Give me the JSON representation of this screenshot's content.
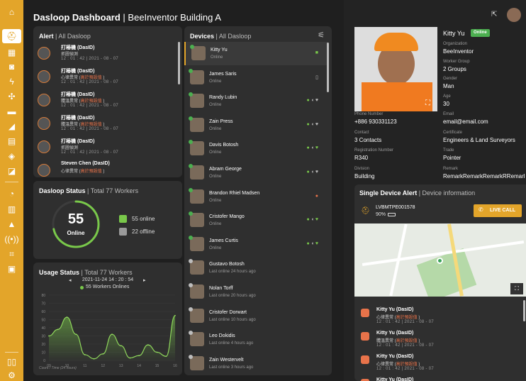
{
  "header": {
    "title": "Dasloop Dashboard",
    "subtitle": "BeeInventor Building A"
  },
  "sidebar": {
    "items": [
      "home-icon",
      "helmet-icon",
      "truck-icon",
      "gas-detector-icon",
      "power-icon",
      "fan-icon",
      "vehicle-icon",
      "excavator-icon",
      "panel-icon",
      "tag-icon",
      "camera-icon",
      "gauge-icon",
      "report-icon",
      "warning-icon",
      "broadcast-icon",
      "path-icon",
      "building-icon",
      "book-icon",
      "settings-icon"
    ]
  },
  "alert": {
    "title": "Alert",
    "scope": "All Dasloop",
    "items": [
      {
        "name": "打樁機 (DasID)",
        "event": "抓圖偵測",
        "warn": "",
        "time": "12 : 01 : 42",
        "date": "2021 - 08 - 07"
      },
      {
        "name": "打樁機 (DasID)",
        "event": "心律異常 (",
        "warn": "高於預設值",
        "time": "12 : 01 : 42",
        "date": "2021 - 08 - 07"
      },
      {
        "name": "打樁機 (DasID)",
        "event": "體溫異常 (",
        "warn": "高於預設值",
        "time": "12 : 01 : 42",
        "date": "2021 - 08 - 07"
      },
      {
        "name": "打樁機 (DasID)",
        "event": "體溫異常 (",
        "warn": "高於預設值",
        "time": "12 : 01 : 42",
        "date": "2021 - 08 - 07"
      },
      {
        "name": "打樁機 (DasID)",
        "event": "抓圖偵測",
        "warn": "",
        "time": "12 : 01 : 42",
        "date": "2021 - 08 - 07"
      },
      {
        "name": "Steven Chen (DasID)",
        "event": "心律異常 (",
        "warn": "高於預設值",
        "time": "",
        "date": ""
      }
    ]
  },
  "status": {
    "title": "Dasloop Status",
    "total": "Total 77 Workers",
    "count": "55",
    "count_label": "Online",
    "online": "55 online",
    "offline": "22 offline",
    "online_fraction": 0.714
  },
  "usage": {
    "title": "Usage Status",
    "total": "Total 77 Workers",
    "datetime": "2021-11-24  14 : 20 : 54",
    "workers": "55 Workers Onlines",
    "footer": "Count / Time (24 hours)"
  },
  "chart_data": {
    "type": "area",
    "x": [
      9,
      10,
      11,
      12,
      13,
      14,
      15,
      16
    ],
    "x_ticks": [
      "09",
      "10",
      "11",
      "12",
      "13",
      "14",
      "15",
      "16"
    ],
    "y_ticks": [
      "80",
      "70",
      "60",
      "50",
      "40",
      "30",
      "20",
      "10",
      "0"
    ],
    "ylim": [
      0,
      80
    ],
    "points": [
      [
        9,
        30
      ],
      [
        9.5,
        38
      ],
      [
        10,
        53
      ],
      [
        10.5,
        32
      ],
      [
        11,
        7
      ],
      [
        11.5,
        2
      ],
      [
        12,
        8
      ],
      [
        12.5,
        32
      ],
      [
        13,
        18
      ],
      [
        13.5,
        3
      ],
      [
        14,
        6
      ],
      [
        14.5,
        19
      ],
      [
        15,
        10
      ],
      [
        15.5,
        5
      ],
      [
        16,
        55
      ]
    ],
    "xlabel": "Count / Time (24 hours)"
  },
  "devices": {
    "title": "Devices",
    "scope": "All Dasloop",
    "items": [
      {
        "name": "Kitty Yu",
        "status": "Online",
        "online": true,
        "icons": "camera"
      },
      {
        "name": "James Saris",
        "status": "Online",
        "online": true,
        "icons": "battery"
      },
      {
        "name": "Randy Lubin",
        "status": "Online",
        "online": true,
        "icons": "full"
      },
      {
        "name": "Zain Press",
        "status": "Online",
        "online": true,
        "icons": "full"
      },
      {
        "name": "Davis Botosh",
        "status": "Online",
        "online": true,
        "icons": "full-green"
      },
      {
        "name": "Abram George",
        "status": "Online",
        "online": true,
        "icons": "full"
      },
      {
        "name": "Brandon Rhiel Madsen",
        "status": "Online",
        "online": true,
        "icons": "helmet"
      },
      {
        "name": "Cristofer Mango",
        "status": "Online",
        "online": true,
        "icons": "full-green"
      },
      {
        "name": "James Curtis",
        "status": "Online",
        "online": true,
        "icons": "full-green"
      },
      {
        "name": "Gustavo Botosh",
        "status": "Last online 24 hours ago",
        "online": false,
        "icons": ""
      },
      {
        "name": "Nolan Torff",
        "status": "Last online 20 hours ago",
        "online": false,
        "icons": ""
      },
      {
        "name": "Cristofer Dorwart",
        "status": "Last online 10 hours ago",
        "online": false,
        "icons": ""
      },
      {
        "name": "Leo Dokidis",
        "status": "Last online 4 hours ago",
        "online": false,
        "icons": ""
      },
      {
        "name": "Zain Westervelt",
        "status": "Last online 3 hours ago",
        "online": false,
        "icons": ""
      }
    ]
  },
  "profile": {
    "name": "Kitty Yu",
    "badge": "Online",
    "fields": [
      {
        "label": "Organization",
        "value": "BeeInventor"
      },
      {
        "label": "Worker Group",
        "value": "2 Groups"
      },
      {
        "label": "Gender",
        "value": "Man"
      },
      {
        "label": "Age",
        "value": "30"
      }
    ],
    "grid": [
      {
        "label": "Phone Number",
        "value": "+886 930331123"
      },
      {
        "label": "Email",
        "value": "email@email.com"
      },
      {
        "label": "Contact",
        "value": "3 Contacts"
      },
      {
        "label": "Certificate",
        "value": "Engineers & Land Surveyors"
      },
      {
        "label": "Registration Number",
        "value": "R340"
      },
      {
        "label": "Trade",
        "value": "Pointer"
      },
      {
        "label": "Division",
        "value": "Building"
      },
      {
        "label": "Remark",
        "value": "RemarkRemarkRemarkRRemark..."
      }
    ]
  },
  "single_alert": {
    "title": "Single Device Alert",
    "subtitle": "Device information",
    "device_id": "LVBMTPE001578",
    "battery": "90%",
    "live_call": "LIVE CALL",
    "items": [
      {
        "name": "Kitty Yu (DasID)",
        "event": "心律異常 (",
        "warn": "高於預設值",
        "time": "12 : 01 : 42",
        "date": "2021 - 08 - 07"
      },
      {
        "name": "Kitty Yu (DasID)",
        "event": "體溫異常 (",
        "warn": "高於預設值",
        "time": "12 : 01 : 42",
        "date": "2021 - 08 - 07"
      },
      {
        "name": "Kitty Yu (DasID)",
        "event": "心律異常 (",
        "warn": "高於預設值",
        "time": "12 : 01 : 42",
        "date": "2021 - 08 - 07"
      },
      {
        "name": "Kitty Yu (DasID)",
        "event": "",
        "warn": "",
        "time": "",
        "date": ""
      }
    ]
  }
}
